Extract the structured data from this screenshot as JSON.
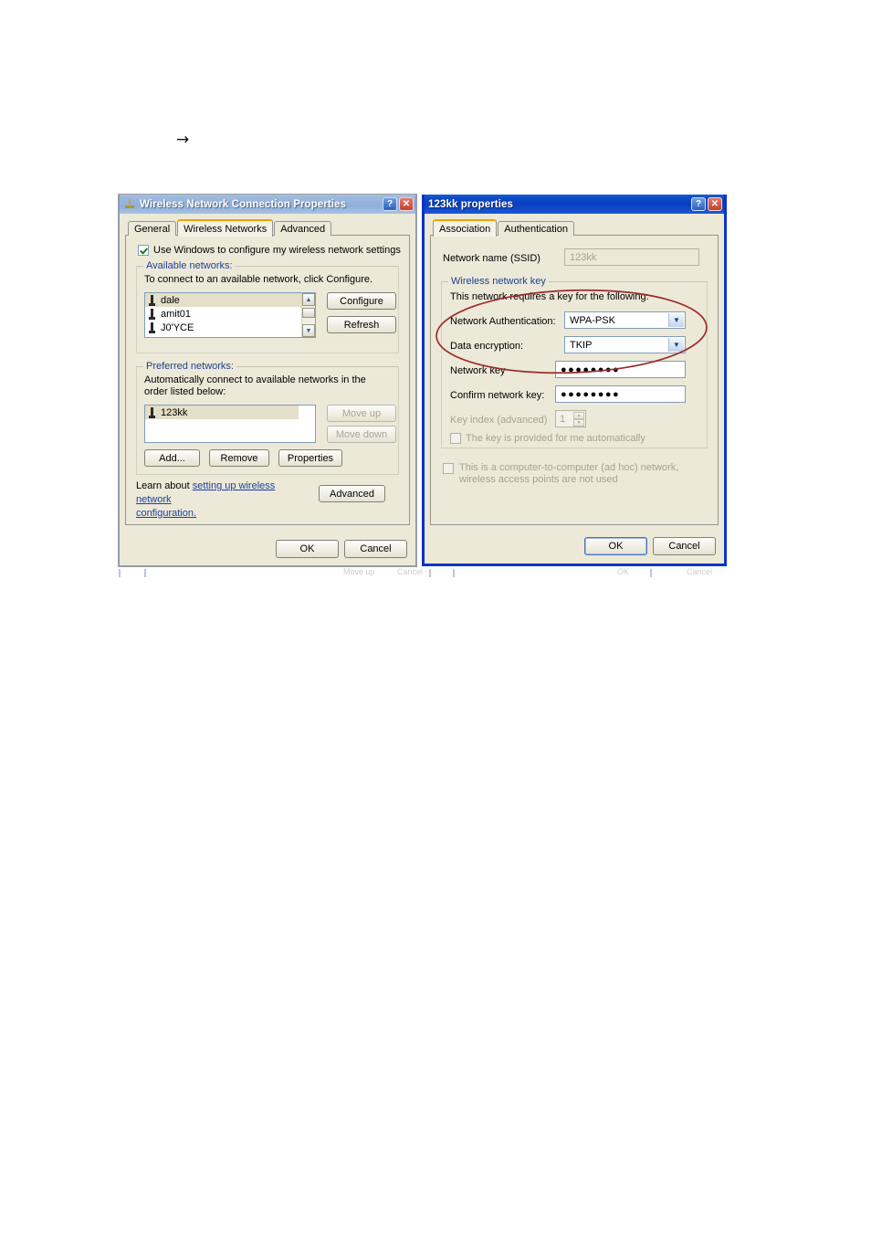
{
  "page": {
    "arrow_glyph": "→"
  },
  "left_dialog": {
    "title": "Wireless Network Connection Properties",
    "title_icon": "wireless-adapter-icon",
    "window_buttons": {
      "help": "?",
      "close": "✕"
    },
    "tabs": [
      {
        "label": "General",
        "active": false
      },
      {
        "label": "Wireless Networks",
        "active": true
      },
      {
        "label": "Advanced",
        "active": false
      }
    ],
    "use_windows_checkbox": {
      "label": "Use Windows to configure my wireless network settings",
      "checked": true
    },
    "available_networks": {
      "group_title": "Available networks:",
      "instruction": "To connect to an available network, click Configure.",
      "items": [
        {
          "name": "dale",
          "selected": true
        },
        {
          "name": "amit01",
          "selected": false
        },
        {
          "name": "J0'YCE",
          "selected": false
        }
      ],
      "buttons": [
        {
          "label": "Configure",
          "enabled": true
        },
        {
          "label": "Refresh",
          "enabled": true
        }
      ],
      "scrollbar": {
        "up": "▲",
        "down": "▼"
      }
    },
    "preferred_networks": {
      "group_title": "Preferred networks:",
      "instruction": "Automatically connect to available networks in the order listed below:",
      "items": [
        {
          "name": "123kk",
          "selected": true
        }
      ],
      "side_buttons": [
        {
          "label": "Move up",
          "enabled": false
        },
        {
          "label": "Move down",
          "enabled": false
        }
      ],
      "bottom_buttons": [
        {
          "label": "Add...",
          "enabled": true
        },
        {
          "label": "Remove",
          "enabled": true
        },
        {
          "label": "Properties",
          "enabled": true
        }
      ]
    },
    "learn_more": {
      "prefix": "Learn about ",
      "link_line1": "setting up wireless network",
      "link_line2": "configuration."
    },
    "advanced_button": "Advanced",
    "footer_buttons": [
      {
        "label": "OK",
        "default": false
      },
      {
        "label": "Cancel",
        "default": false
      }
    ]
  },
  "right_dialog": {
    "title": "123kk properties",
    "window_buttons": {
      "help": "?",
      "close": "✕"
    },
    "tabs": [
      {
        "label": "Association",
        "active": true
      },
      {
        "label": "Authentication",
        "active": false
      }
    ],
    "ssid_field": {
      "label": "Network name (SSID)",
      "value": "123kk",
      "enabled": false
    },
    "wireless_key_group": {
      "group_title": "Wireless network key",
      "description": "This network requires a key for the following:",
      "network_authentication": {
        "label": "Network Authentication:",
        "value": "WPA-PSK"
      },
      "data_encryption": {
        "label": "Data encryption:",
        "value": "TKIP"
      },
      "network_key": {
        "label": "Network key",
        "value": "●●●●●●●●"
      },
      "confirm_network_key": {
        "label": "Confirm network key:",
        "value": "●●●●●●●●"
      },
      "key_index": {
        "label": "Key index (advanced)",
        "value": "1",
        "enabled": false
      },
      "auto_key_checkbox": {
        "label": "The key is provided for me automatically",
        "checked": false,
        "enabled": false
      }
    },
    "adhoc_checkbox": {
      "label": "This is a computer-to-computer (ad hoc) network, wireless access points are not used",
      "checked": false,
      "enabled": false
    },
    "footer_buttons": [
      {
        "label": "OK",
        "default": true
      },
      {
        "label": "Cancel",
        "default": false
      }
    ]
  },
  "annotation": {
    "type": "red-ellipse",
    "color": "#9d2b2b",
    "targets": [
      "Network Authentication:",
      "Data encryption:"
    ]
  }
}
